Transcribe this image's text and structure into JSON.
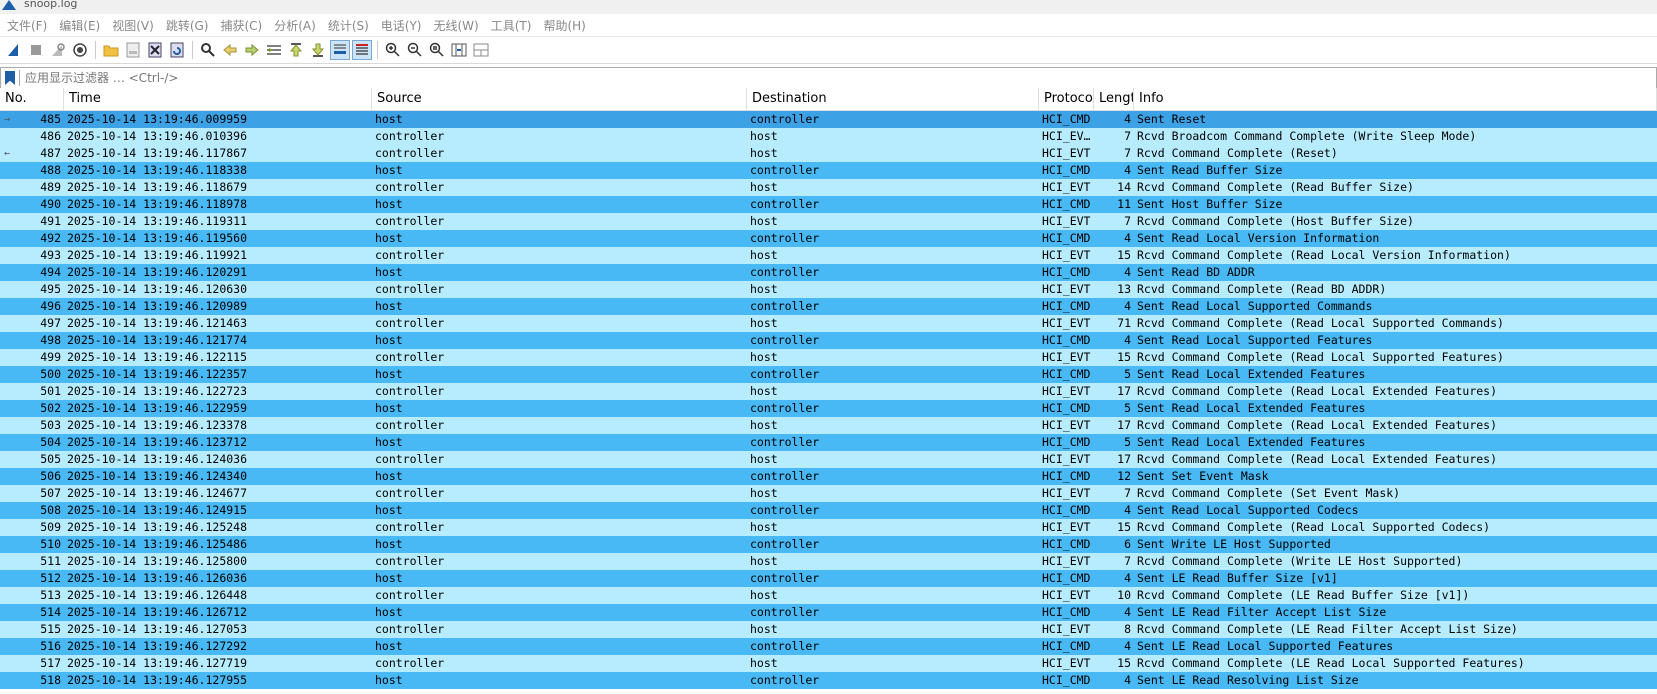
{
  "window": {
    "title": "snoop.log"
  },
  "menu": [
    "文件(F)",
    "编辑(E)",
    "视图(V)",
    "跳转(G)",
    "捕获(C)",
    "分析(A)",
    "统计(S)",
    "电话(Y)",
    "无线(W)",
    "工具(T)",
    "帮助(H)"
  ],
  "filter": {
    "placeholder": "应用显示过滤器 … <Ctrl-/>"
  },
  "columns": [
    "No.",
    "Time",
    "Source",
    "Destination",
    "Protoco",
    "Lengt",
    "Info"
  ],
  "colors": {
    "sent_row": "#49b9f6",
    "rcvd_row": "#b6ecfd",
    "selected_row": "#3da1e6"
  },
  "packets": [
    {
      "no": "485",
      "time": "2025-10-14 13:19:46.009959",
      "src": "host",
      "dst": "controller",
      "proto": "HCI_CMD",
      "len": "4",
      "info": "Sent Reset",
      "marker": "→",
      "selected": true
    },
    {
      "no": "486",
      "time": "2025-10-14 13:19:46.010396",
      "src": "controller",
      "dst": "host",
      "proto": "HCI_EV…",
      "len": "7",
      "info": "Rcvd Broadcom Command Complete (Write Sleep Mode)"
    },
    {
      "no": "487",
      "time": "2025-10-14 13:19:46.117867",
      "src": "controller",
      "dst": "host",
      "proto": "HCI_EVT",
      "len": "7",
      "info": "Rcvd Command Complete (Reset)",
      "marker": "←"
    },
    {
      "no": "488",
      "time": "2025-10-14 13:19:46.118338",
      "src": "host",
      "dst": "controller",
      "proto": "HCI_CMD",
      "len": "4",
      "info": "Sent Read Buffer Size"
    },
    {
      "no": "489",
      "time": "2025-10-14 13:19:46.118679",
      "src": "controller",
      "dst": "host",
      "proto": "HCI_EVT",
      "len": "14",
      "info": "Rcvd Command Complete (Read Buffer Size)"
    },
    {
      "no": "490",
      "time": "2025-10-14 13:19:46.118978",
      "src": "host",
      "dst": "controller",
      "proto": "HCI_CMD",
      "len": "11",
      "info": "Sent Host Buffer Size"
    },
    {
      "no": "491",
      "time": "2025-10-14 13:19:46.119311",
      "src": "controller",
      "dst": "host",
      "proto": "HCI_EVT",
      "len": "7",
      "info": "Rcvd Command Complete (Host Buffer Size)"
    },
    {
      "no": "492",
      "time": "2025-10-14 13:19:46.119560",
      "src": "host",
      "dst": "controller",
      "proto": "HCI_CMD",
      "len": "4",
      "info": "Sent Read Local Version Information"
    },
    {
      "no": "493",
      "time": "2025-10-14 13:19:46.119921",
      "src": "controller",
      "dst": "host",
      "proto": "HCI_EVT",
      "len": "15",
      "info": "Rcvd Command Complete (Read Local Version Information)"
    },
    {
      "no": "494",
      "time": "2025-10-14 13:19:46.120291",
      "src": "host",
      "dst": "controller",
      "proto": "HCI_CMD",
      "len": "4",
      "info": "Sent Read BD ADDR"
    },
    {
      "no": "495",
      "time": "2025-10-14 13:19:46.120630",
      "src": "controller",
      "dst": "host",
      "proto": "HCI_EVT",
      "len": "13",
      "info": "Rcvd Command Complete (Read BD ADDR)"
    },
    {
      "no": "496",
      "time": "2025-10-14 13:19:46.120989",
      "src": "host",
      "dst": "controller",
      "proto": "HCI_CMD",
      "len": "4",
      "info": "Sent Read Local Supported Commands"
    },
    {
      "no": "497",
      "time": "2025-10-14 13:19:46.121463",
      "src": "controller",
      "dst": "host",
      "proto": "HCI_EVT",
      "len": "71",
      "info": "Rcvd Command Complete (Read Local Supported Commands)"
    },
    {
      "no": "498",
      "time": "2025-10-14 13:19:46.121774",
      "src": "host",
      "dst": "controller",
      "proto": "HCI_CMD",
      "len": "4",
      "info": "Sent Read Local Supported Features"
    },
    {
      "no": "499",
      "time": "2025-10-14 13:19:46.122115",
      "src": "controller",
      "dst": "host",
      "proto": "HCI_EVT",
      "len": "15",
      "info": "Rcvd Command Complete (Read Local Supported Features)"
    },
    {
      "no": "500",
      "time": "2025-10-14 13:19:46.122357",
      "src": "host",
      "dst": "controller",
      "proto": "HCI_CMD",
      "len": "5",
      "info": "Sent Read Local Extended Features"
    },
    {
      "no": "501",
      "time": "2025-10-14 13:19:46.122723",
      "src": "controller",
      "dst": "host",
      "proto": "HCI_EVT",
      "len": "17",
      "info": "Rcvd Command Complete (Read Local Extended Features)"
    },
    {
      "no": "502",
      "time": "2025-10-14 13:19:46.122959",
      "src": "host",
      "dst": "controller",
      "proto": "HCI_CMD",
      "len": "5",
      "info": "Sent Read Local Extended Features"
    },
    {
      "no": "503",
      "time": "2025-10-14 13:19:46.123378",
      "src": "controller",
      "dst": "host",
      "proto": "HCI_EVT",
      "len": "17",
      "info": "Rcvd Command Complete (Read Local Extended Features)"
    },
    {
      "no": "504",
      "time": "2025-10-14 13:19:46.123712",
      "src": "host",
      "dst": "controller",
      "proto": "HCI_CMD",
      "len": "5",
      "info": "Sent Read Local Extended Features"
    },
    {
      "no": "505",
      "time": "2025-10-14 13:19:46.124036",
      "src": "controller",
      "dst": "host",
      "proto": "HCI_EVT",
      "len": "17",
      "info": "Rcvd Command Complete (Read Local Extended Features)"
    },
    {
      "no": "506",
      "time": "2025-10-14 13:19:46.124340",
      "src": "host",
      "dst": "controller",
      "proto": "HCI_CMD",
      "len": "12",
      "info": "Sent Set Event Mask"
    },
    {
      "no": "507",
      "time": "2025-10-14 13:19:46.124677",
      "src": "controller",
      "dst": "host",
      "proto": "HCI_EVT",
      "len": "7",
      "info": "Rcvd Command Complete (Set Event Mask)"
    },
    {
      "no": "508",
      "time": "2025-10-14 13:19:46.124915",
      "src": "host",
      "dst": "controller",
      "proto": "HCI_CMD",
      "len": "4",
      "info": "Sent Read Local Supported Codecs"
    },
    {
      "no": "509",
      "time": "2025-10-14 13:19:46.125248",
      "src": "controller",
      "dst": "host",
      "proto": "HCI_EVT",
      "len": "15",
      "info": "Rcvd Command Complete (Read Local Supported Codecs)"
    },
    {
      "no": "510",
      "time": "2025-10-14 13:19:46.125486",
      "src": "host",
      "dst": "controller",
      "proto": "HCI_CMD",
      "len": "6",
      "info": "Sent Write LE Host Supported"
    },
    {
      "no": "511",
      "time": "2025-10-14 13:19:46.125800",
      "src": "controller",
      "dst": "host",
      "proto": "HCI_EVT",
      "len": "7",
      "info": "Rcvd Command Complete (Write LE Host Supported)"
    },
    {
      "no": "512",
      "time": "2025-10-14 13:19:46.126036",
      "src": "host",
      "dst": "controller",
      "proto": "HCI_CMD",
      "len": "4",
      "info": "Sent LE Read Buffer Size [v1]"
    },
    {
      "no": "513",
      "time": "2025-10-14 13:19:46.126448",
      "src": "controller",
      "dst": "host",
      "proto": "HCI_EVT",
      "len": "10",
      "info": "Rcvd Command Complete (LE Read Buffer Size [v1])"
    },
    {
      "no": "514",
      "time": "2025-10-14 13:19:46.126712",
      "src": "host",
      "dst": "controller",
      "proto": "HCI_CMD",
      "len": "4",
      "info": "Sent LE Read Filter Accept List Size"
    },
    {
      "no": "515",
      "time": "2025-10-14 13:19:46.127053",
      "src": "controller",
      "dst": "host",
      "proto": "HCI_EVT",
      "len": "8",
      "info": "Rcvd Command Complete (LE Read Filter Accept List Size)"
    },
    {
      "no": "516",
      "time": "2025-10-14 13:19:46.127292",
      "src": "host",
      "dst": "controller",
      "proto": "HCI_CMD",
      "len": "4",
      "info": "Sent LE Read Local Supported Features"
    },
    {
      "no": "517",
      "time": "2025-10-14 13:19:46.127719",
      "src": "controller",
      "dst": "host",
      "proto": "HCI_EVT",
      "len": "15",
      "info": "Rcvd Command Complete (LE Read Local Supported Features)"
    },
    {
      "no": "518",
      "time": "2025-10-14 13:19:46.127955",
      "src": "host",
      "dst": "controller",
      "proto": "HCI_CMD",
      "len": "4",
      "info": "Sent LE Read Resolving List Size"
    }
  ]
}
